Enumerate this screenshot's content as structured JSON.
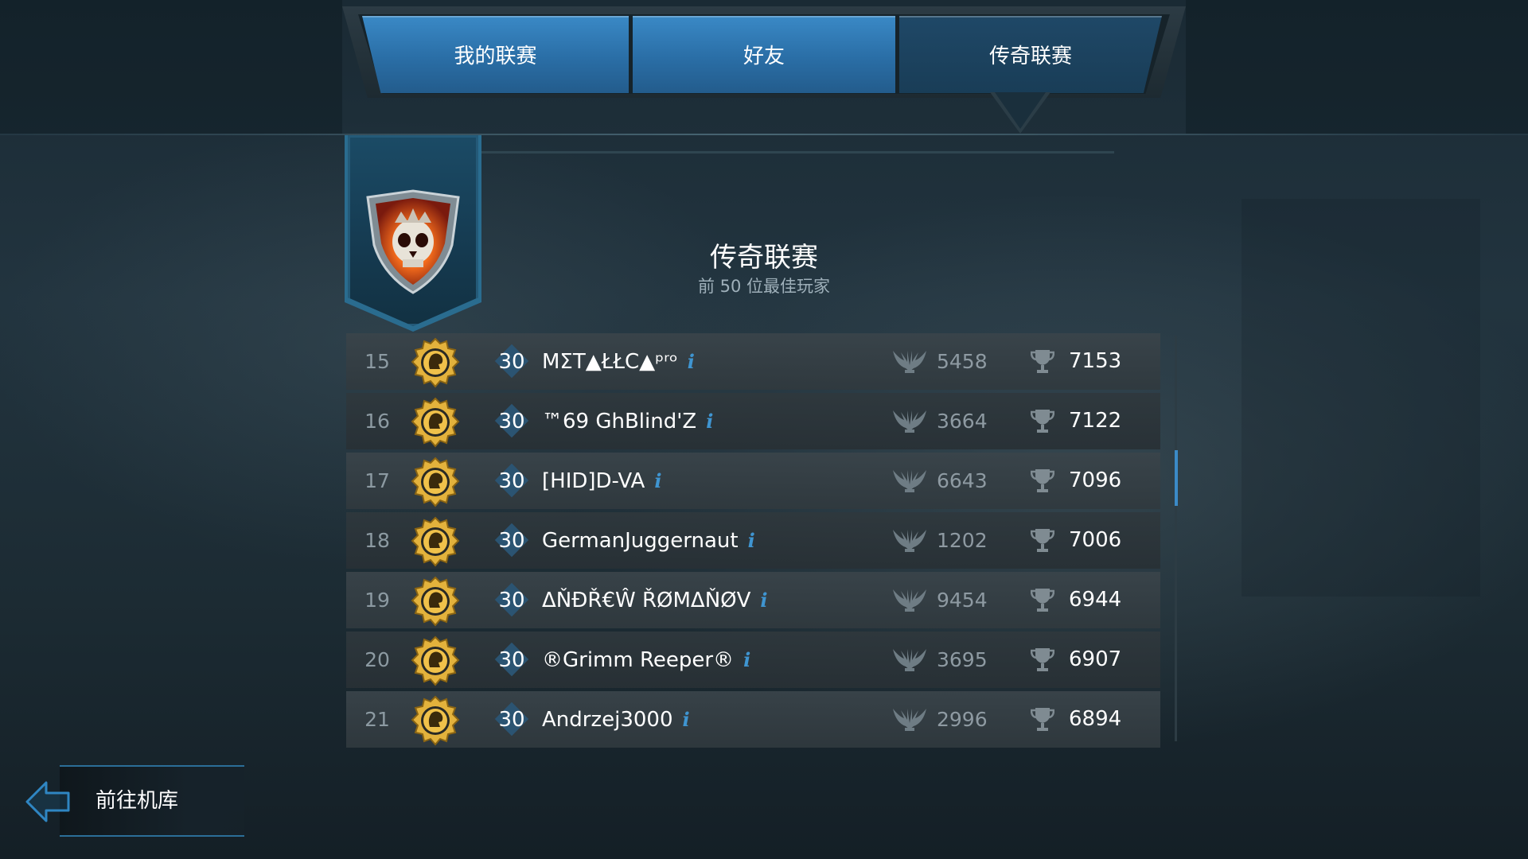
{
  "tabs": {
    "my_league": "我的联赛",
    "friends": "好友",
    "legend_league": "传奇联赛"
  },
  "league": {
    "title": "传奇联赛",
    "subtitle": "前 50 位最佳玩家"
  },
  "leaderboard": [
    {
      "rank": "15",
      "level": "30",
      "name": "MΣT▲ŁŁC▲ᵖʳᵒ",
      "score1": "5458",
      "score2": "7153"
    },
    {
      "rank": "16",
      "level": "30",
      "name": "™69 GhBlind'Z",
      "score1": "3664",
      "score2": "7122"
    },
    {
      "rank": "17",
      "level": "30",
      "name": "[HID]D-VA",
      "score1": "6643",
      "score2": "7096"
    },
    {
      "rank": "18",
      "level": "30",
      "name": "GermanJuggernaut",
      "score1": "1202",
      "score2": "7006"
    },
    {
      "rank": "19",
      "level": "30",
      "name": "ΔŇĐŘ€Ŵ ŘØMΔŇØV",
      "score1": "9454",
      "score2": "6944"
    },
    {
      "rank": "20",
      "level": "30",
      "name": "®Grimm Reeper®",
      "score1": "3695",
      "score2": "6907"
    },
    {
      "rank": "21",
      "level": "30",
      "name": "Andrzej3000",
      "score1": "2996",
      "score2": "6894"
    }
  ],
  "info_icon": "i",
  "back_button": {
    "label": "前往机库"
  },
  "colors": {
    "tab_active": "#2e77b2",
    "tab_selected": "#1c4462",
    "info_accent": "#3f95d1",
    "medal_gold": "#e3b23c"
  }
}
